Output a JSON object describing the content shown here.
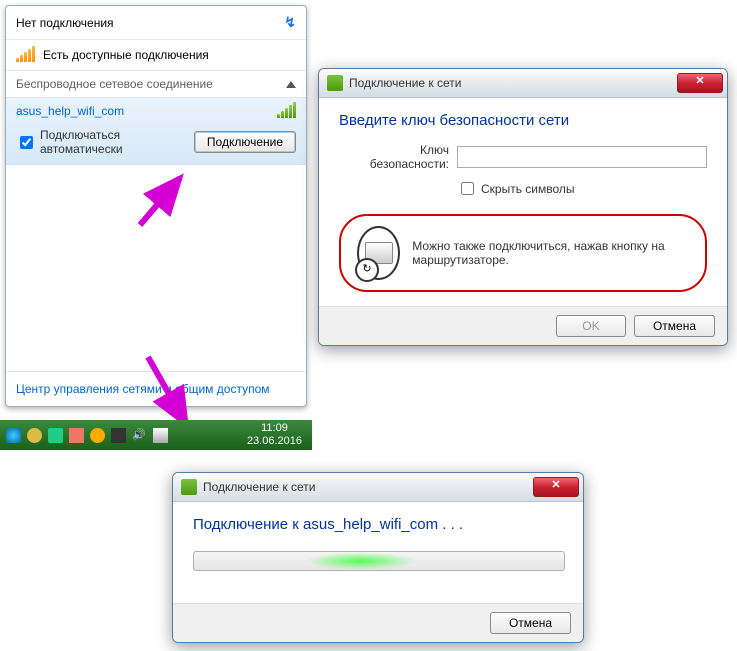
{
  "flyout": {
    "header": "Нет подключения",
    "status": "Есть доступные подключения",
    "section": "Беспроводное сетевое соединение",
    "network_name": "asus_help_wifi_com",
    "auto_connect": "Подключаться автоматически",
    "connect_btn": "Подключение",
    "footer": "Центр управления сетями и общим доступом"
  },
  "security_dialog": {
    "title": "Подключение к сети",
    "heading": "Введите ключ безопасности сети",
    "key_label": "Ключ безопасности:",
    "hide_chars": "Скрыть символы",
    "hint": "Можно также подключиться, нажав кнопку на маршрутизаторе.",
    "ok": "OK",
    "cancel": "Отмена"
  },
  "progress_dialog": {
    "title": "Подключение к сети",
    "message": "Подключение к asus_help_wifi_com . . .",
    "cancel": "Отмена"
  },
  "taskbar": {
    "time": "11:09",
    "date": "23.06.2016"
  }
}
